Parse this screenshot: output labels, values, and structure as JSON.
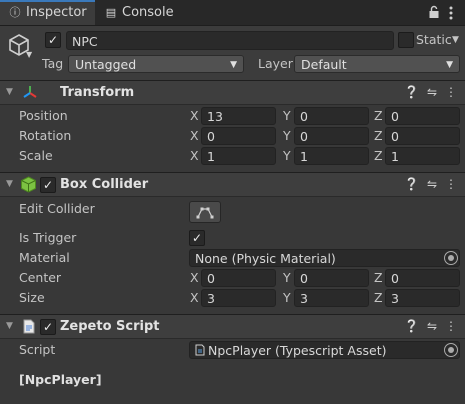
{
  "tabs": [
    {
      "label": "Inspector",
      "icon": "info-icon"
    },
    {
      "label": "Console",
      "icon": "console-icon"
    }
  ],
  "header": {
    "name": "NPC",
    "active": true,
    "static_label": "Static",
    "tag_label": "Tag",
    "tag_value": "Untagged",
    "layer_label": "Layer",
    "layer_value": "Default"
  },
  "transform": {
    "title": "Transform",
    "rows": [
      {
        "label": "Position",
        "x": "13",
        "y": "0",
        "z": "0"
      },
      {
        "label": "Rotation",
        "x": "0",
        "y": "0",
        "z": "0"
      },
      {
        "label": "Scale",
        "x": "1",
        "y": "1",
        "z": "1"
      }
    ]
  },
  "box_collider": {
    "title": "Box Collider",
    "edit_label": "Edit Collider",
    "is_trigger_label": "Is Trigger",
    "is_trigger": true,
    "material_label": "Material",
    "material_value": "None (Physic Material)",
    "center": {
      "label": "Center",
      "x": "0",
      "y": "0",
      "z": "0"
    },
    "size": {
      "label": "Size",
      "x": "3",
      "y": "3",
      "z": "3"
    }
  },
  "zepeto_script": {
    "title": "Zepeto Script",
    "script_label": "Script",
    "script_value": "NpcPlayer (Typescript Asset)",
    "class_tag": "[NpcPlayer]"
  },
  "axes": {
    "x": "X",
    "y": "Y",
    "z": "Z"
  },
  "colors": {
    "accent": "#3a79bb",
    "background": "#383838",
    "field": "#2a2a2a"
  }
}
